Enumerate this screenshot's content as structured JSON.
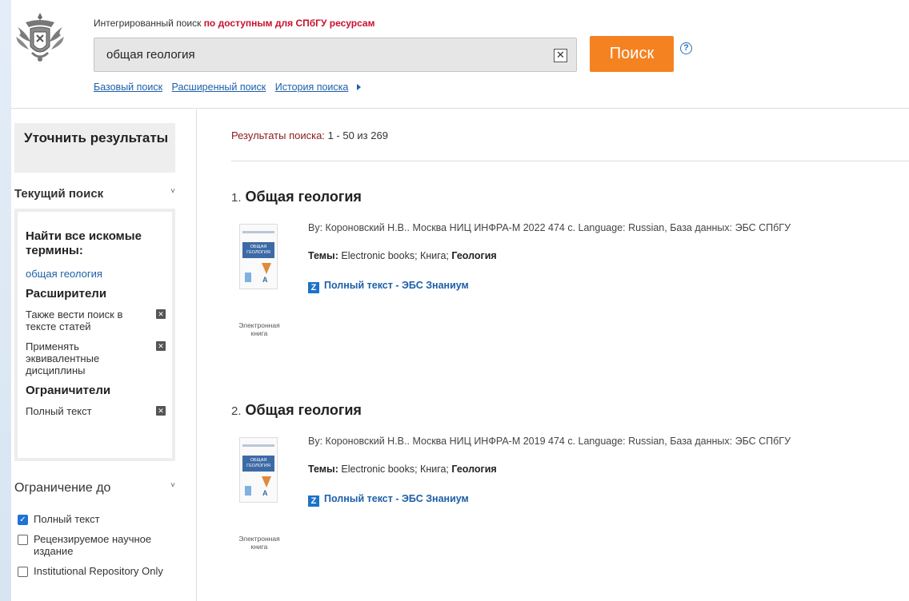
{
  "header": {
    "search_label_prefix": "Интегрированный поиск",
    "search_label_bold": "по доступным для СПбГУ ресурсам",
    "search_value": "общая геология",
    "clear_symbol": "✕",
    "search_button": "Поиск",
    "help_symbol": "?",
    "nav": {
      "basic": "Базовый поиск",
      "advanced": "Расширенный поиск",
      "history": "История поиска"
    }
  },
  "sidebar": {
    "refine_title": "Уточнить результаты",
    "current_search_title": "Текущий поиск",
    "find_all_terms": "Найти все искомые термины:",
    "query_link": "общая геология",
    "expanders_title": "Расширители",
    "expanders": [
      "Также вести поиск в тексте статей",
      "Применять эквивалентные дисциплины"
    ],
    "limiters_title": "Ограничители",
    "limiters": [
      "Полный текст"
    ],
    "limit_to_title": "Ограничение до",
    "limit_options": [
      {
        "label": "Полный текст",
        "checked": true
      },
      {
        "label": "Рецензируемое научное издание",
        "checked": false
      },
      {
        "label": "Institutional Repository Only",
        "checked": false
      }
    ]
  },
  "results": {
    "count_label": "Результаты поиска:",
    "count_value": "1 - 50 из 269",
    "items": [
      {
        "num": "1.",
        "title": "Общая геология",
        "meta": "By: Короновский Н.В.. Москва НИЦ ИНФРА-М 2022 474 с. Language: Russian, База данных: ЭБС СПбГУ",
        "subjects_label": "Темы:",
        "subjects_plain": "Electronic books; Книга;",
        "subjects_bold": "Геология",
        "fulltext": "Полный текст - ЭБС Знаниум",
        "format": "Электронная книга",
        "cover_title": "ОБЩАЯ ГЕОЛОГИЯ"
      },
      {
        "num": "2.",
        "title": "Общая геология",
        "meta": "By: Короновский Н.В.. Москва НИЦ ИНФРА-М 2019 474 с. Language: Russian, База данных: ЭБС СПбГУ",
        "subjects_label": "Темы:",
        "subjects_plain": "Electronic books; Книга;",
        "subjects_bold": "Геология",
        "fulltext": "Полный текст - ЭБС Знаниум",
        "format": "Электронная книга",
        "cover_title": "ОБЩАЯ ГЕОЛОГИЯ"
      }
    ]
  },
  "colors": {
    "accent_orange": "#f58220",
    "link_blue": "#1d5fa8",
    "label_red": "#c8102e",
    "count_label": "#8b1c1c"
  }
}
